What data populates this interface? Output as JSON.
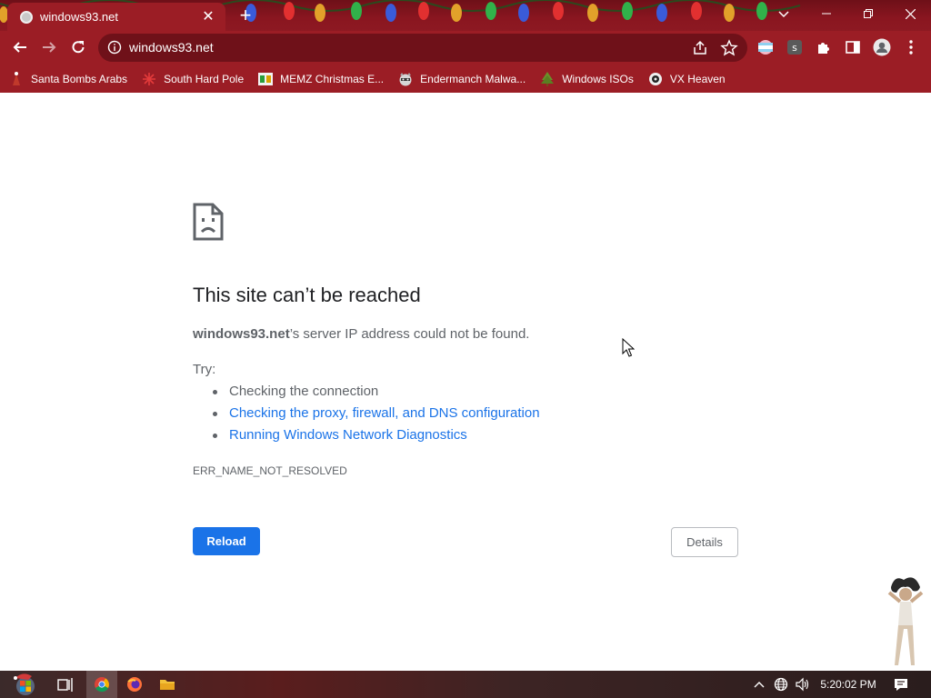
{
  "tab": {
    "title": "windows93.net",
    "close_label": "✕"
  },
  "newtab_label": "+",
  "omnibox": {
    "url": "windows93.net"
  },
  "bookmarks": [
    {
      "label": "Santa Bombs Arabs",
      "icon": "santa-icon"
    },
    {
      "label": "South Hard Pole",
      "icon": "snowflake-icon"
    },
    {
      "label": "MEMZ Christmas E...",
      "icon": "memz-icon"
    },
    {
      "label": "Endermanch Malwa...",
      "icon": "raccoon-icon"
    },
    {
      "label": "Windows ISOs",
      "icon": "tree-icon"
    },
    {
      "label": "VX Heaven",
      "icon": "vx-icon"
    }
  ],
  "error": {
    "title": "This site can’t be reached",
    "host": "windows93.net",
    "desc_rest": "’s server IP address could not be found.",
    "try_label": "Try:",
    "suggestions": [
      "Checking the connection",
      "Checking the proxy, firewall, and DNS configuration",
      "Running Windows Network Diagnostics"
    ],
    "code": "ERR_NAME_NOT_RESOLVED",
    "reload_label": "Reload",
    "details_label": "Details"
  },
  "taskbar": {
    "clock": "5:20:02 PM"
  },
  "colors": {
    "frame": "#9b1d25",
    "omnibox": "#6f1119",
    "primary_button": "#1a73e8",
    "link": "#1a73e8",
    "text": "#202124",
    "muted_text": "#5f6368"
  }
}
